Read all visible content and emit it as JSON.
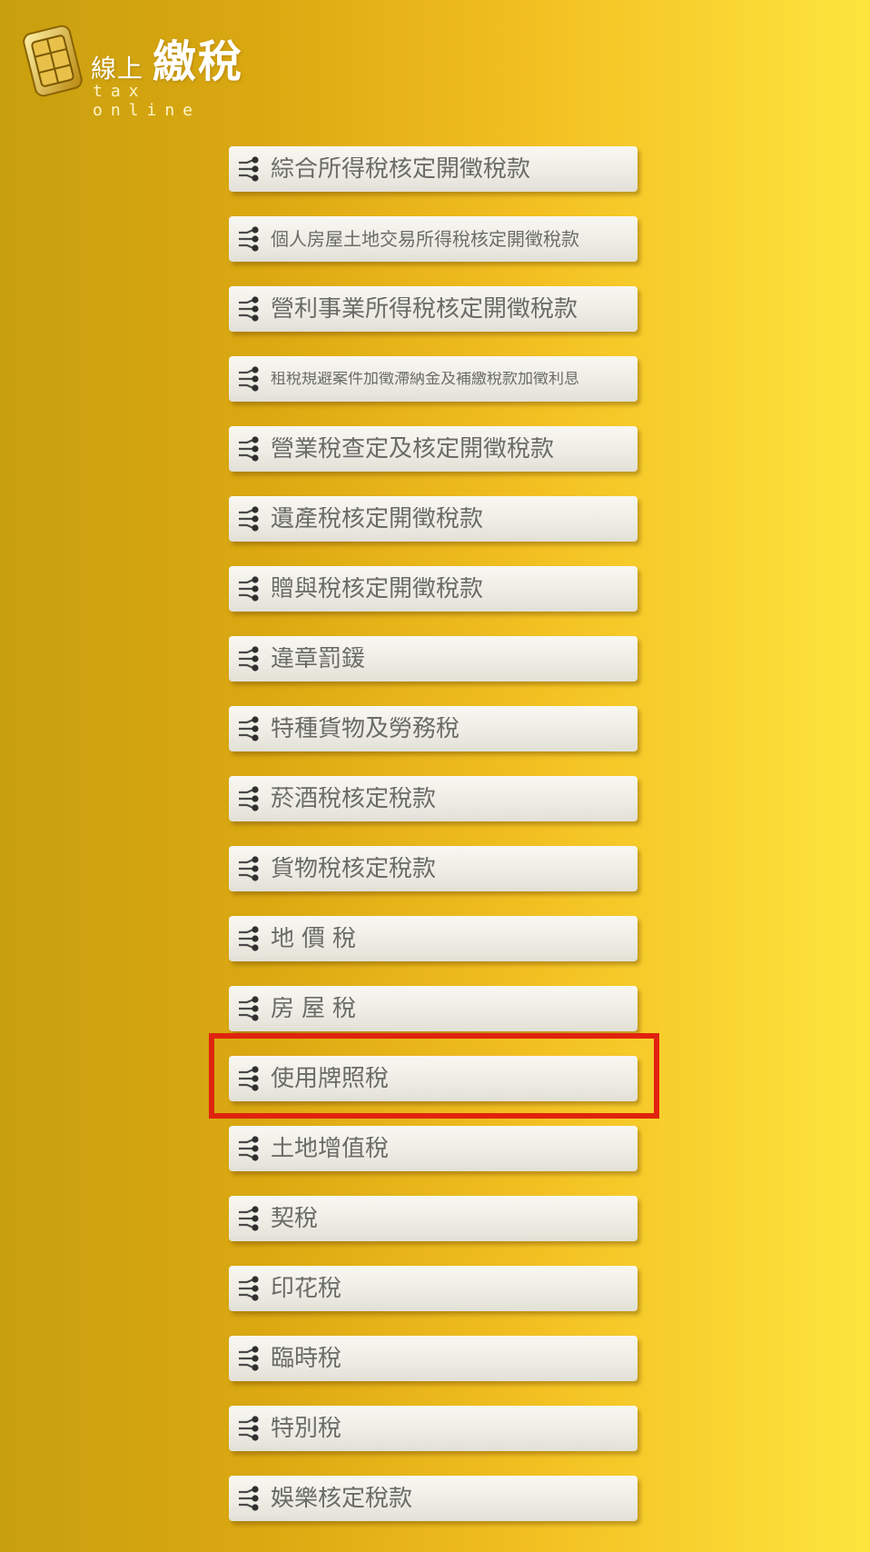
{
  "logo": {
    "zh_small": "線上",
    "zh_big": "繳稅",
    "en": "tax online"
  },
  "colors": {
    "highlight": "#e0230f",
    "button_text": "#6b6b68"
  },
  "menu": {
    "items": [
      {
        "label": "綜合所得稅核定開徵稅款",
        "icon": "node-branch-icon"
      },
      {
        "label": "個人房屋土地交易所得稅核定開徵稅款",
        "icon": "node-branch-icon"
      },
      {
        "label": "營利事業所得稅核定開徵稅款",
        "icon": "node-branch-icon"
      },
      {
        "label": "租稅規避案件加徵滯納金及補繳稅款加徵利息",
        "icon": "node-branch-icon"
      },
      {
        "label": "營業稅查定及核定開徵稅款",
        "icon": "node-branch-icon"
      },
      {
        "label": "遺產稅核定開徵稅款",
        "icon": "node-branch-icon"
      },
      {
        "label": "贈與稅核定開徵稅款",
        "icon": "node-branch-icon"
      },
      {
        "label": "違章罰鍰",
        "icon": "node-branch-icon"
      },
      {
        "label": "特種貨物及勞務稅",
        "icon": "node-branch-icon"
      },
      {
        "label": "菸酒稅核定稅款",
        "icon": "node-branch-icon"
      },
      {
        "label": "貨物稅核定稅款",
        "icon": "node-branch-icon"
      },
      {
        "label": "地價稅",
        "icon": "node-branch-icon"
      },
      {
        "label": "房屋稅",
        "icon": "node-branch-icon"
      },
      {
        "label": "使用牌照稅",
        "icon": "node-branch-icon",
        "highlighted": true
      },
      {
        "label": "土地增值稅",
        "icon": "node-branch-icon"
      },
      {
        "label": "契稅",
        "icon": "node-branch-icon"
      },
      {
        "label": "印花稅",
        "icon": "node-branch-icon"
      },
      {
        "label": "臨時稅",
        "icon": "node-branch-icon"
      },
      {
        "label": "特別稅",
        "icon": "node-branch-icon"
      },
      {
        "label": "娛樂核定稅款",
        "icon": "node-branch-icon"
      }
    ]
  }
}
